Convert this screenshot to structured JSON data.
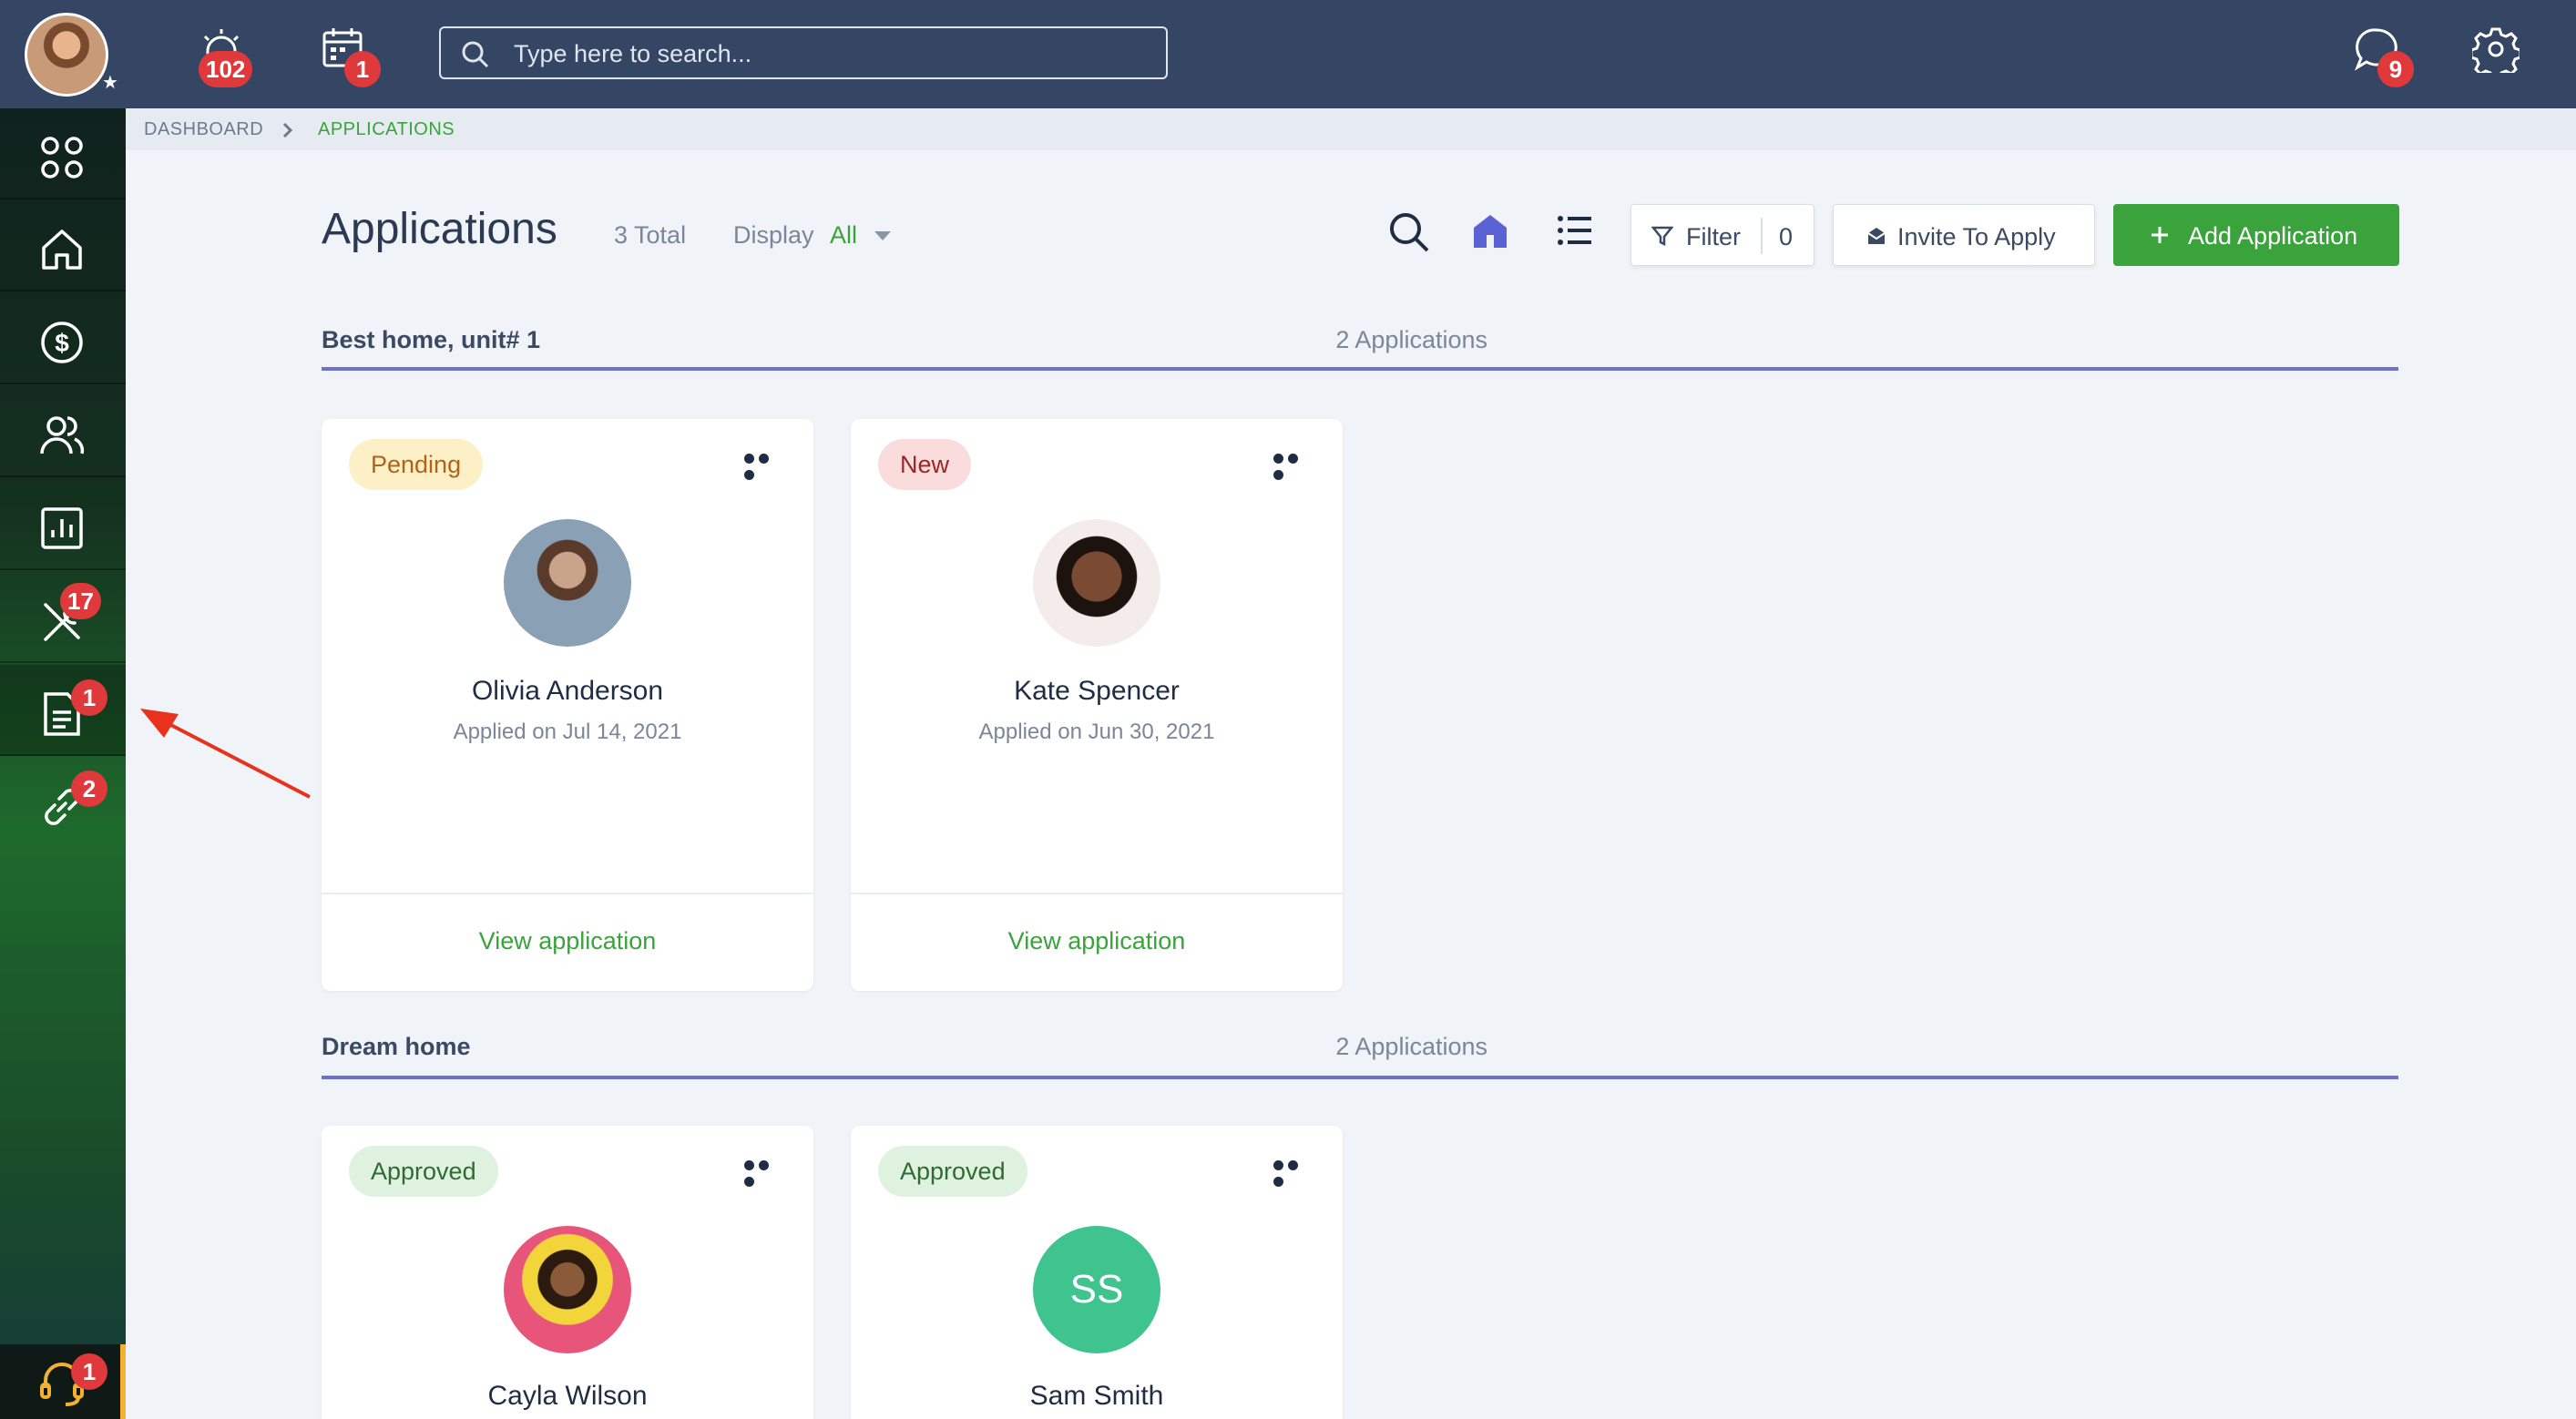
{
  "topbar": {
    "alerts_count": "102",
    "calendar_count": "1",
    "search_placeholder": "Type here to search...",
    "messages_count": "9"
  },
  "sidebar": {
    "items": [
      {
        "icon": "apps-grid-icon",
        "badge": ""
      },
      {
        "icon": "home-icon",
        "badge": ""
      },
      {
        "icon": "dollar-circle-icon",
        "badge": ""
      },
      {
        "icon": "people-icon",
        "badge": ""
      },
      {
        "icon": "reports-chart-icon",
        "badge": ""
      },
      {
        "icon": "tools-icon",
        "badge": "17"
      },
      {
        "icon": "applications-document-icon",
        "badge": "1"
      },
      {
        "icon": "link-icon",
        "badge": "2"
      }
    ],
    "support_badge": "1"
  },
  "breadcrumb": {
    "root": "DASHBOARD",
    "current": "APPLICATIONS"
  },
  "header": {
    "title": "Applications",
    "total": "3 Total",
    "display_label": "Display",
    "display_value": "All",
    "filter_label": "Filter",
    "filter_count": "0",
    "invite_label": "Invite To Apply",
    "add_label": "Add Application"
  },
  "colors": {
    "accent": "#3aa33c",
    "topbar": "#354664",
    "section_line": "#6c71cf",
    "badge": "#e0393c"
  },
  "sections": [
    {
      "title": "Best home, unit# 1",
      "count": "2 Applications",
      "cards": [
        {
          "status": "Pending",
          "name": "Olivia Anderson",
          "applied": "Applied on Jul 14, 2021",
          "link": "View application"
        },
        {
          "status": "New",
          "name": "Kate Spencer",
          "applied": "Applied on Jun 30, 2021",
          "link": "View application"
        }
      ]
    },
    {
      "title": "Dream home",
      "count": "2 Applications",
      "cards": [
        {
          "status": "Approved",
          "name": "Cayla Wilson"
        },
        {
          "status": "Approved",
          "name": "Sam Smith",
          "initials": "SS"
        }
      ]
    }
  ]
}
